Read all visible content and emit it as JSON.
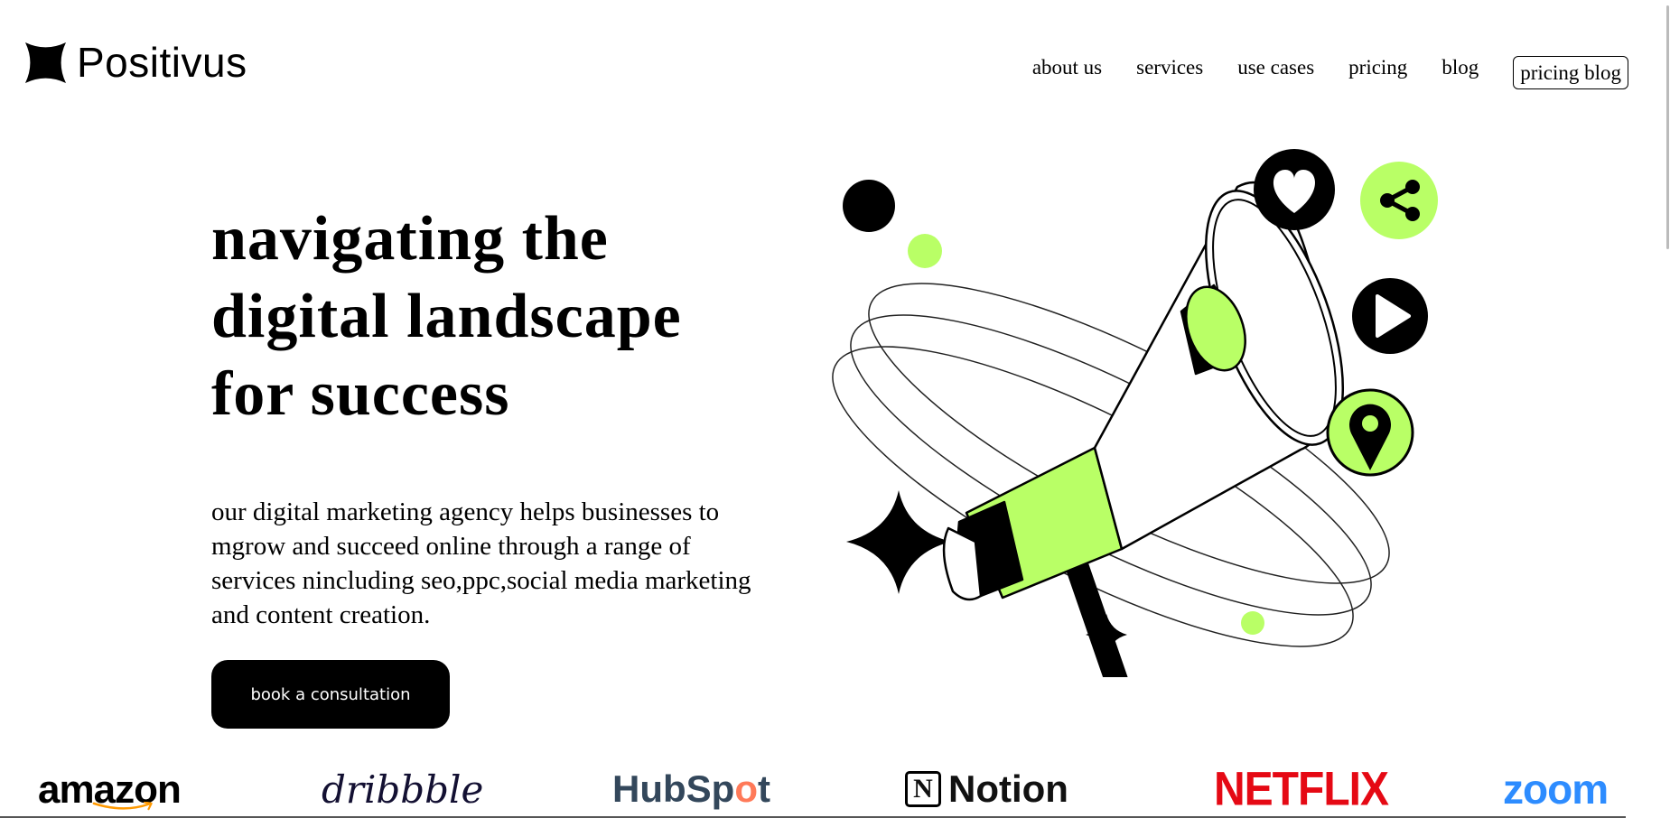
{
  "header": {
    "brand_name": "Positivus",
    "nav": [
      "about us",
      "services",
      "use cases",
      "pricing",
      "blog"
    ],
    "nav_button": "pricing blog"
  },
  "hero": {
    "title_lines": [
      "navigating the",
      "digital landscape",
      "for success"
    ],
    "description": "our digital marketing agency helps businesses to mgrow and succeed online through a range of services nincluding seo,ppc,social media marketing and content creation.",
    "cta": "book a consultation"
  },
  "illustration": {
    "icons": [
      "megaphone-icon",
      "heart-icon",
      "share-icon",
      "play-icon",
      "location-pin-icon",
      "sparkle-icon"
    ],
    "accent_color": "#b9ff66"
  },
  "brands": {
    "amazon": "amazon",
    "dribbble": "dribbble",
    "hubspot_a": "HubSp",
    "hubspot_o": "o",
    "hubspot_b": "t",
    "notion_letter": "N",
    "notion": "Notion",
    "netflix": "NETFLIX",
    "zoom": "zoom"
  },
  "colors": {
    "accent": "#b9ff66",
    "black": "#000000",
    "netflix": "#e50914",
    "zoom": "#2d8cff",
    "hubspot": "#33475b",
    "hubspot_accent": "#ff7a59",
    "amazon_smile": "#ff9900"
  }
}
